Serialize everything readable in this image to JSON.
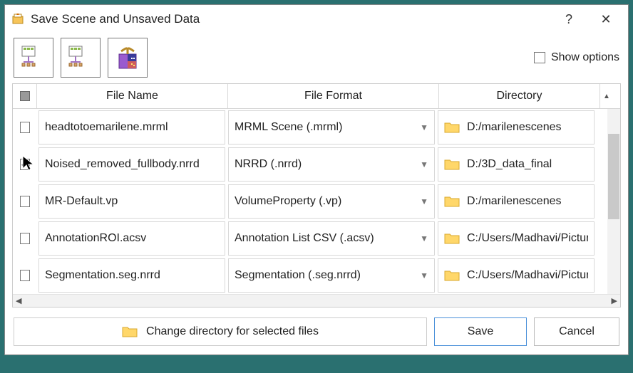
{
  "window": {
    "title": "Save Scene and Unsaved Data",
    "help_symbol": "?",
    "close_symbol": "✕"
  },
  "toolbar": {
    "show_options_label": "Show options"
  },
  "columns": {
    "name": "File Name",
    "format": "File Format",
    "directory": "Directory"
  },
  "rows": [
    {
      "checked": false,
      "name": "headtotoemarilene.mrml",
      "format": "MRML Scene (.mrml)",
      "dir": "D:/marilenescenes"
    },
    {
      "checked": true,
      "name": "Noised_removed_fullbody.nrrd",
      "format": "NRRD (.nrrd)",
      "dir": "D:/3D_data_final"
    },
    {
      "checked": false,
      "name": "MR-Default.vp",
      "format": "VolumeProperty (.vp)",
      "dir": "D:/marilenescenes"
    },
    {
      "checked": false,
      "name": "AnnotationROI.acsv",
      "format": "Annotation List CSV (.acsv)",
      "dir": "C:/Users/Madhavi/Picture"
    },
    {
      "checked": false,
      "name": "Segmentation.seg.nrrd",
      "format": "Segmentation (.seg.nrrd)",
      "dir": "C:/Users/Madhavi/Picture"
    }
  ],
  "footer": {
    "change_dir_label": "Change directory for selected files",
    "save_label": "Save",
    "cancel_label": "Cancel"
  },
  "icons": {
    "caret": "▼",
    "scroll_up": "▲",
    "scroll_left": "◀",
    "scroll_right": "▶"
  }
}
